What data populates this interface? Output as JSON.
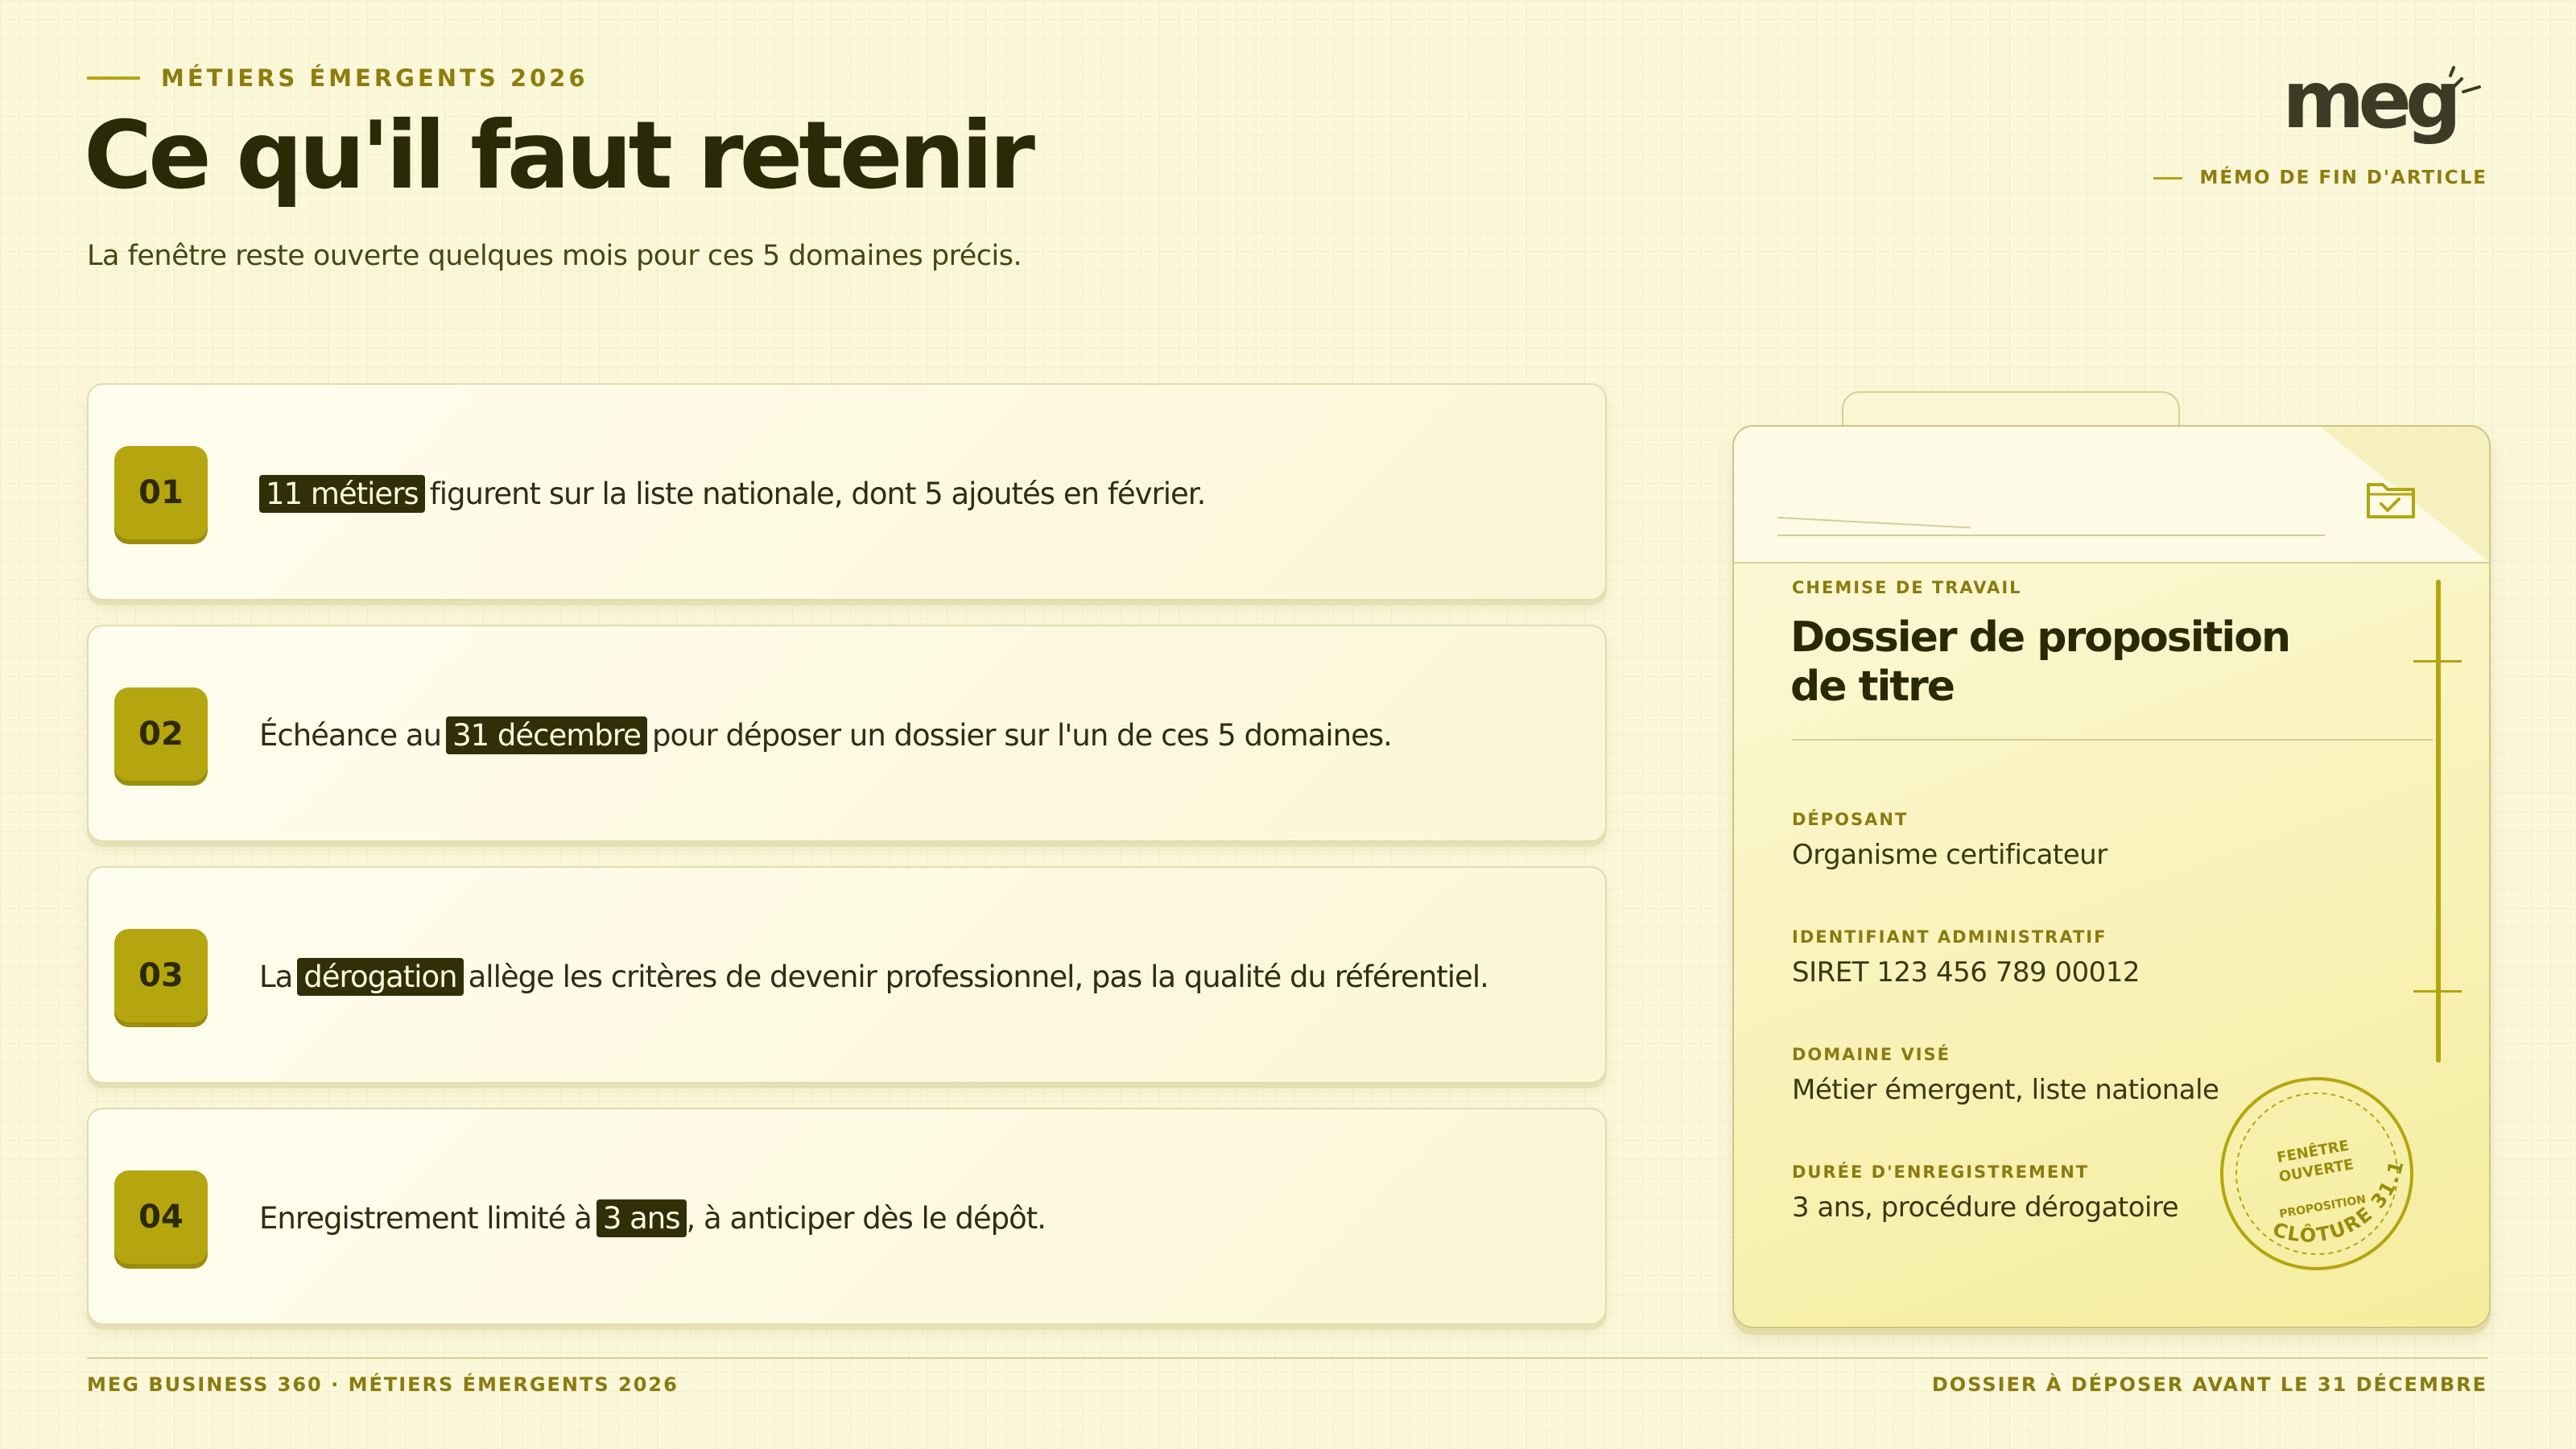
{
  "header": {
    "eyebrow": "MÉTIERS ÉMERGENTS 2026",
    "title": "Ce qu'il faut retenir",
    "subtitle": "La fenêtre reste ouverte quelques mois pour ces 5 domaines précis.",
    "logo": "meg",
    "memo": "MÉMO DE FIN D'ARTICLE"
  },
  "items": [
    {
      "number": "01",
      "before": "",
      "highlight": "11 métiers",
      "after": "figurent sur la liste nationale, dont 5 ajoutés en février."
    },
    {
      "number": "02",
      "before": "Échéance au",
      "highlight": "31 décembre",
      "after": "pour déposer un dossier sur l'un de ces 5 domaines."
    },
    {
      "number": "03",
      "before": "La",
      "highlight": "dérogation",
      "after": "allège les critères de devenir professionnel, pas la qualité du référentiel."
    },
    {
      "number": "04",
      "before": "Enregistrement limité à",
      "highlight": "3 ans",
      "after": ", à anticiper dès le dépôt."
    }
  ],
  "folder": {
    "kicker": "CHEMISE DE TRAVAIL",
    "title": "Dossier de proposition de titre",
    "fields": [
      {
        "label": "DÉPOSANT",
        "value": "Organisme certificateur"
      },
      {
        "label": "IDENTIFIANT ADMINISTRATIF",
        "value": "SIRET 123 456 789 00012"
      },
      {
        "label": "DOMAINE VISÉ",
        "value": "Métier émergent, liste nationale"
      },
      {
        "label": "DURÉE D'ENREGISTREMENT",
        "value": "3 ans, procédure dérogatoire"
      }
    ],
    "stamp": {
      "line1": "FENÊTRE",
      "line2": "OUVERTE",
      "line3": "PROPOSITION",
      "arc": "CLÔTURE 31.12"
    }
  },
  "footer": {
    "left": "MEG BUSINESS 360 · MÉTIERS ÉMERGENTS 2026",
    "right": "DOSSIER À DÉPOSER AVANT LE 31 DÉCEMBRE"
  },
  "colors": {
    "accent": "#b5a60f",
    "dark": "#2a2906",
    "background": "#fbf7d9"
  }
}
